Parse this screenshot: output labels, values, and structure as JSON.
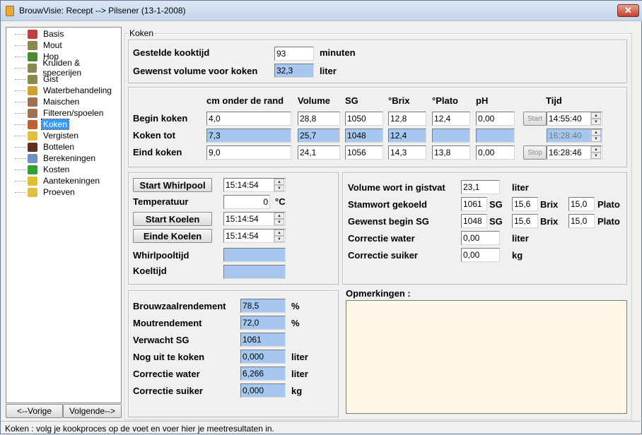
{
  "window": {
    "title": "BrouwVisie: Recept -->  Pilsener (13-1-2008)",
    "close": "✕"
  },
  "tree": [
    {
      "label": "Basis",
      "icon": "calendar-icon",
      "color": "#c04040"
    },
    {
      "label": "Mout",
      "icon": "malt-sack-icon",
      "color": "#8a8a50"
    },
    {
      "label": "Hop",
      "icon": "hop-icon",
      "color": "#4a8a30"
    },
    {
      "label": "Kruiden & specerijen",
      "icon": "spice-sack-icon",
      "color": "#8a8a50"
    },
    {
      "label": "Gist",
      "icon": "yeast-sack-icon",
      "color": "#8a8a50"
    },
    {
      "label": "Waterbehandeling",
      "icon": "water-jug-icon",
      "color": "#d0a030"
    },
    {
      "label": "Maischen",
      "icon": "mash-tun-icon",
      "color": "#a07050"
    },
    {
      "label": "Filteren/spoelen",
      "icon": "filter-icon",
      "color": "#a07050"
    },
    {
      "label": "Koken",
      "icon": "kettle-icon",
      "color": "#c06030"
    },
    {
      "label": "Vergisten",
      "icon": "beer-glass-icon",
      "color": "#e0c040"
    },
    {
      "label": "Bottelen",
      "icon": "bottle-icon",
      "color": "#603020"
    },
    {
      "label": "Berekeningen",
      "icon": "calculator-icon",
      "color": "#7090c0"
    },
    {
      "label": "Kosten",
      "icon": "money-icon",
      "color": "#30a030"
    },
    {
      "label": "Aantekeningen",
      "icon": "notes-icon",
      "color": "#e0c030"
    },
    {
      "label": "Proeven",
      "icon": "tasting-glasses-icon",
      "color": "#e0c040"
    }
  ],
  "nav": {
    "prev": "<--Vorige",
    "next": "Volgende-->"
  },
  "group_title": "Koken",
  "kooktijd": {
    "label": "Gestelde kooktijd",
    "value": "93",
    "unit": "minuten"
  },
  "volume_voor": {
    "label": "Gewenst volume voor koken",
    "value": "32,3",
    "unit": "liter"
  },
  "table": {
    "headers": [
      "cm onder de rand",
      "Volume",
      "SG",
      "°Brix",
      "°Plato",
      "pH",
      "Tijd"
    ],
    "rows": [
      {
        "label": "Begin koken",
        "values": [
          "4,0",
          "28,8",
          "1050",
          "12,8",
          "12,4",
          "0,00"
        ],
        "button": "Start",
        "time": "14:55:40"
      },
      {
        "label": "Koken tot",
        "values": [
          "7,3",
          "25,7",
          "1048",
          "12,4",
          "",
          ""
        ],
        "button": "",
        "time": "16:28:40"
      },
      {
        "label": "Eind koken",
        "values": [
          "9,0",
          "24,1",
          "1056",
          "14,3",
          "13,8",
          "0,00"
        ],
        "button": "Stop",
        "time": "16:28:46"
      }
    ]
  },
  "whirlpool": {
    "start_whirlpool": "Start Whirlpool",
    "start_whirlpool_time": "15:14:54",
    "temp_label": "Temperatuur",
    "temp_value": "0",
    "temp_unit": "°C",
    "start_koelen": "Start Koelen",
    "start_koelen_time": "15:14:54",
    "einde_koelen": "Einde Koelen",
    "einde_koelen_time": "15:14:54",
    "whirlpooltijd": "Whirlpooltijd",
    "whirlpooltijd_value": "",
    "koeltijd": "Koeltijd",
    "koeltijd_value": ""
  },
  "gistvat": {
    "volume_label": "Volume wort in gistvat",
    "volume_value": "23,1",
    "volume_unit": "liter",
    "stamwort_label": "Stamwort gekoeld",
    "stamwort_sg": "1061",
    "stamwort_brix": "15,6",
    "stamwort_plato": "15,0",
    "gewenst_label": "Gewenst begin SG",
    "gewenst_sg": "1048",
    "gewenst_brix": "15,6",
    "gewenst_plato": "15,0",
    "sg": "SG",
    "brix": "Brix",
    "plato": "Plato",
    "cwater_label": "Correctie water",
    "cwater_value": "0,00",
    "cwater_unit": "liter",
    "csuiker_label": "Correctie suiker",
    "csuiker_value": "0,00",
    "csuiker_unit": "kg"
  },
  "results": [
    {
      "label": "Brouwzaalrendement",
      "value": "78,5",
      "unit": "%"
    },
    {
      "label": "Moutrendement",
      "value": "72,0",
      "unit": "%"
    },
    {
      "label": "Verwacht SG",
      "value": "1061",
      "unit": ""
    },
    {
      "label": "Nog uit te koken",
      "value": "0,000",
      "unit": "liter"
    },
    {
      "label": "Correctie water",
      "value": "6,266",
      "unit": "liter"
    },
    {
      "label": "Correctie suiker",
      "value": "0,000",
      "unit": "kg"
    }
  ],
  "remarks": {
    "label": "Opmerkingen :",
    "value": ""
  },
  "status": "Koken : volg je kookproces op de voet en voer hier je meetresultaten in.",
  "colors": {
    "computed_field": "#a6c8f0",
    "remarks_bg": "#fdf8e6",
    "selection": "#3399ff"
  }
}
